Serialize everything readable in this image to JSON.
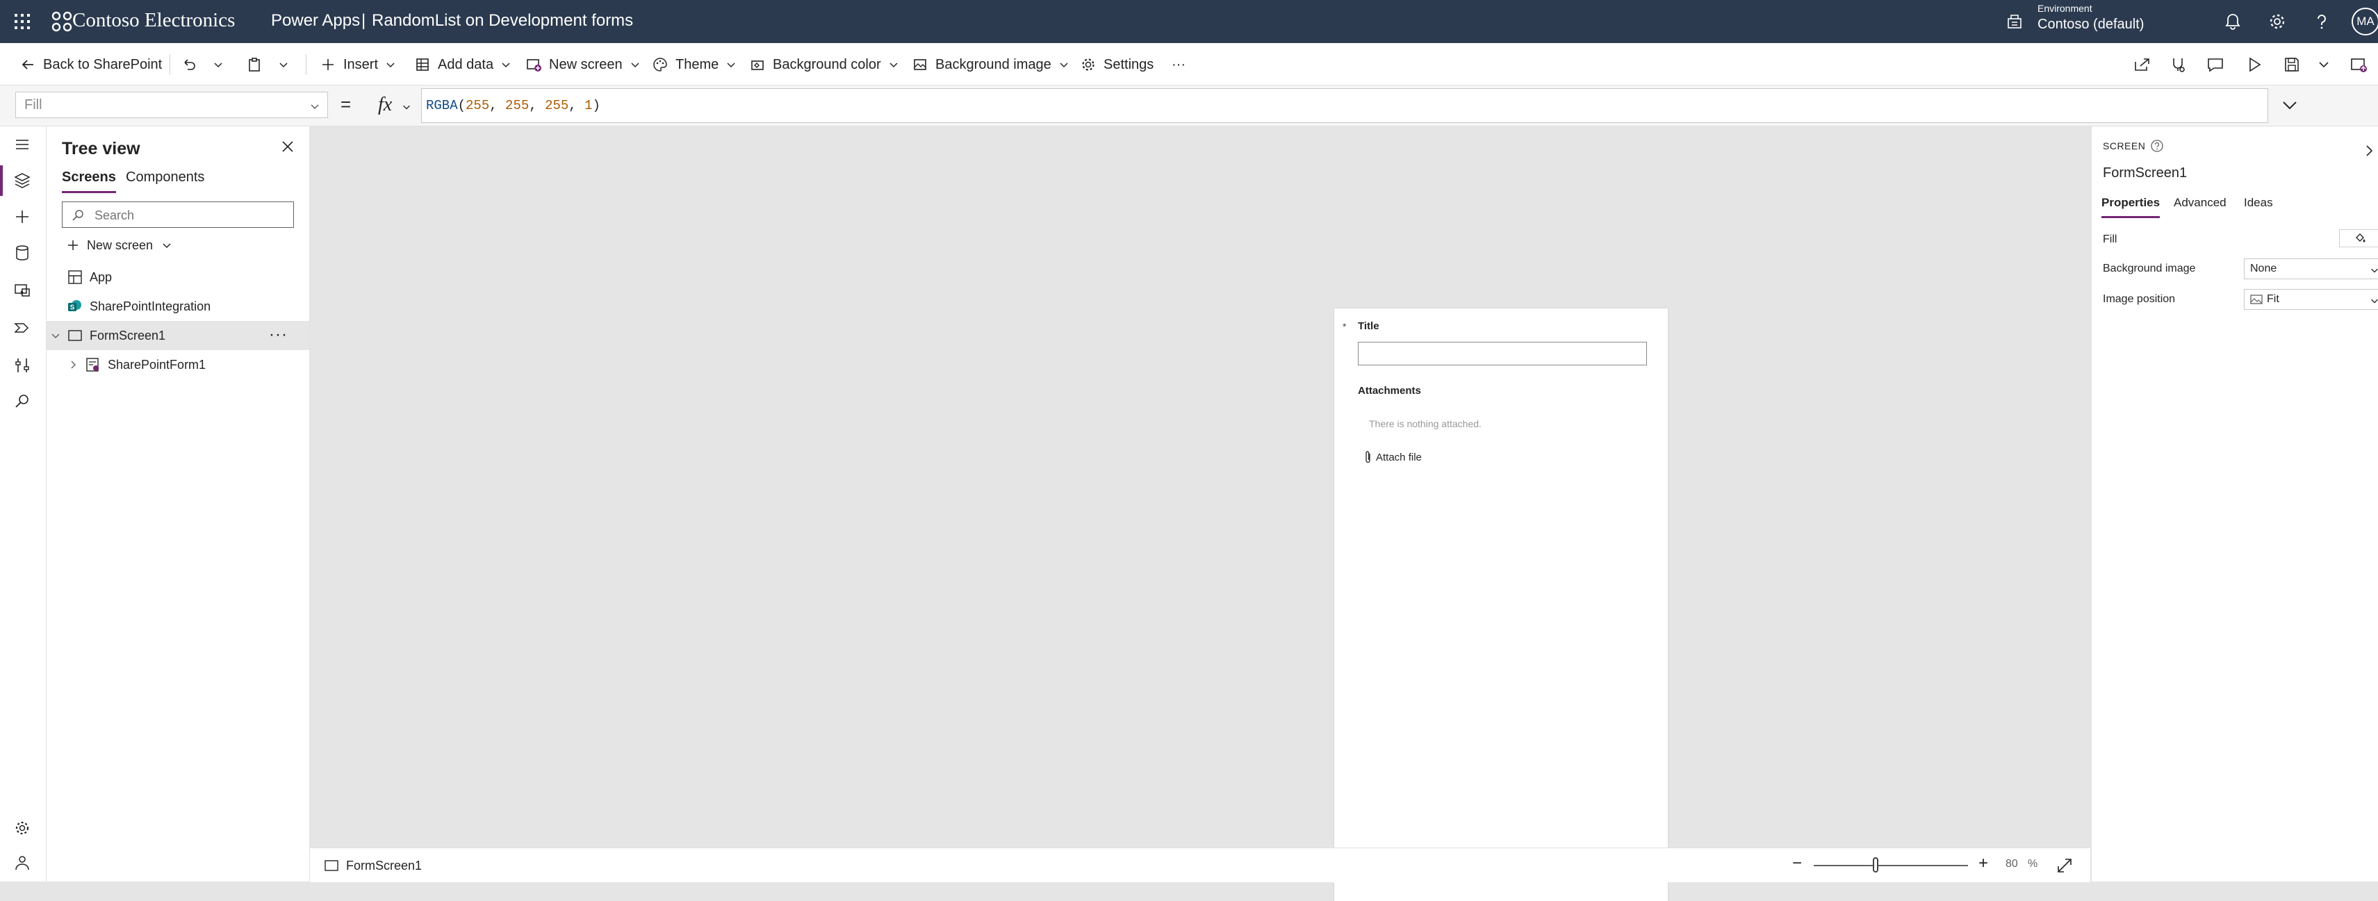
{
  "header": {
    "org_name": "Contoso Electronics",
    "app_name": "Power Apps",
    "separator": "|",
    "app_title": "RandomList on Development forms",
    "environment_label": "Environment",
    "environment_value": "Contoso (default)",
    "avatar_initials": "MA",
    "bg_color": "#2b3a4f"
  },
  "commandbar": {
    "back": "Back to SharePoint",
    "insert": "Insert",
    "add_data": "Add data",
    "new_screen": "New screen",
    "theme": "Theme",
    "background_color": "Background color",
    "background_image": "Background image",
    "settings": "Settings",
    "more": "···"
  },
  "formula": {
    "property": "Fill",
    "equals": "=",
    "fx": "fx",
    "fn": "RGBA",
    "open": "(",
    "r": "255",
    "g": "255",
    "b": "255",
    "a": "1",
    "comma": ", ",
    "close": ")"
  },
  "tree": {
    "title": "Tree view",
    "tab_screens": "Screens",
    "tab_components": "Components",
    "search_placeholder": "Search",
    "new_screen": "New screen",
    "nodes": [
      {
        "label": "App"
      },
      {
        "label": "SharePointIntegration"
      },
      {
        "label": "FormScreen1"
      },
      {
        "label": "SharePointForm1"
      }
    ],
    "more": "···"
  },
  "form": {
    "required_mark": "*",
    "title_label": "Title",
    "title_value": "",
    "attachments_label": "Attachments",
    "nothing_attached": "There is nothing attached.",
    "attach_file": "Attach file"
  },
  "status": {
    "screen_name": "FormScreen1",
    "zoom_minus": "−",
    "zoom_plus": "+",
    "zoom_value": "80",
    "zoom_unit": "%"
  },
  "properties": {
    "type": "SCREEN",
    "name": "FormScreen1",
    "tab_properties": "Properties",
    "tab_advanced": "Advanced",
    "tab_ideas": "Ideas",
    "fill_label": "Fill",
    "background_image_label": "Background image",
    "background_image_value": "None",
    "image_position_label": "Image position",
    "image_position_value": "Fit"
  },
  "colors": {
    "accent": "#742774",
    "sharepoint": "#036c70"
  }
}
